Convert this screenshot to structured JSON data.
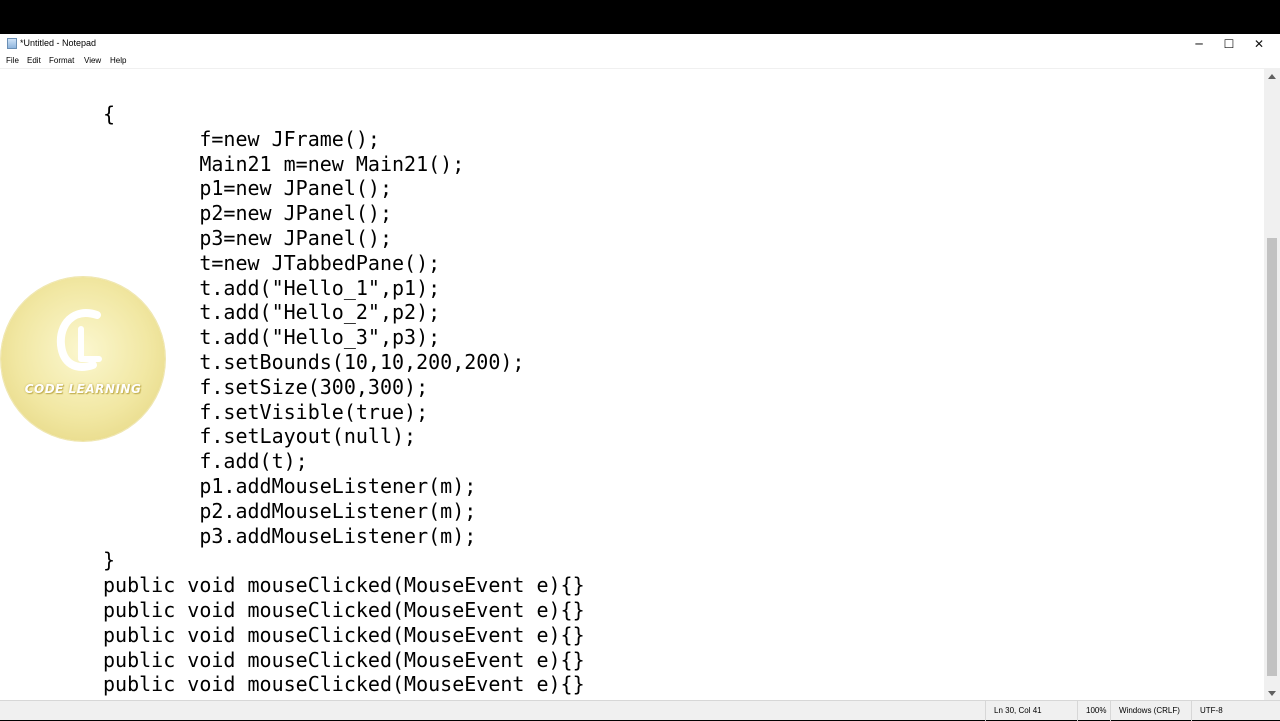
{
  "window": {
    "title": "*Untitled - Notepad",
    "controls": {
      "minimize": "─",
      "maximize": "☐",
      "close": "✕"
    }
  },
  "menu": [
    "File",
    "Edit",
    "Format",
    "View",
    "Help"
  ],
  "editor": {
    "lines": [
      "{",
      "        f=new JFrame();",
      "        Main21 m=new Main21();",
      "        p1=new JPanel();",
      "        p2=new JPanel();",
      "        p3=new JPanel();",
      "        t=new JTabbedPane();",
      "        t.add(\"Hello_1\",p1);",
      "        t.add(\"Hello_2\",p2);",
      "        t.add(\"Hello_3\",p3);",
      "        t.setBounds(10,10,200,200);",
      "        f.setSize(300,300);",
      "        f.setVisible(true);",
      "        f.setLayout(null);",
      "        f.add(t);",
      "        p1.addMouseListener(m);",
      "        p2.addMouseListener(m);",
      "        p3.addMouseListener(m);",
      "}",
      "public void mouseClicked(MouseEvent e){}",
      "public void mouseClicked(MouseEvent e){}",
      "public void mouseClicked(MouseEvent e){}",
      "public void mouseClicked(MouseEvent e){}",
      "public void mouseClicked(MouseEvent e){}"
    ]
  },
  "status": {
    "position": "Ln 30, Col 41",
    "zoom": "100%",
    "line_endings": "Windows (CRLF)",
    "encoding": "UTF-8"
  },
  "watermark": {
    "text": "CODE LEARNING"
  },
  "colors": {
    "chrome": "#f0f0f0",
    "editor_bg": "#ffffff",
    "logo": "#f1e7a2"
  }
}
